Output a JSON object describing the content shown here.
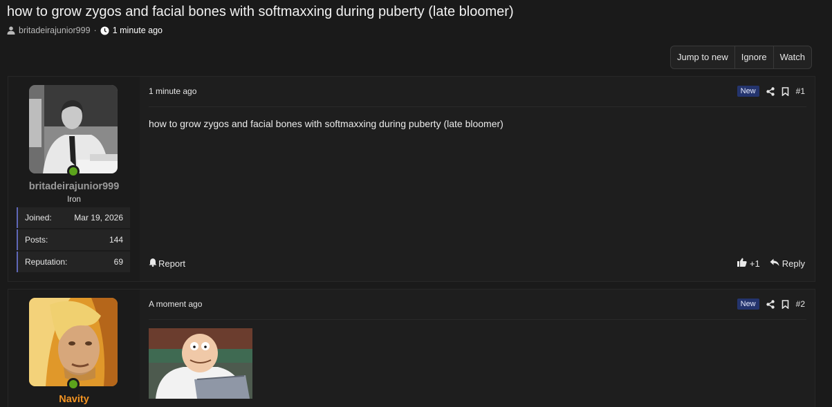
{
  "thread": {
    "title": "how to grow zygos and facial bones with softmaxxing during puberty (late bloomer)",
    "author": "britadeirajunior999",
    "separator": "·",
    "time": "1 minute ago"
  },
  "actions": {
    "jump_to_new": "Jump to new",
    "ignore": "Ignore",
    "watch": "Watch"
  },
  "posts": [
    {
      "username": "britadeirajunior999",
      "user_title": "Iron",
      "stats": [
        {
          "label": "Joined:",
          "value": "Mar 19, 2026"
        },
        {
          "label": "Posts:",
          "value": "144"
        },
        {
          "label": "Reputation:",
          "value": "69"
        }
      ],
      "date": "1 minute ago",
      "badge": "New",
      "number": "#1",
      "body": "how to grow zygos and facial bones with softmaxxing during puberty (late bloomer)",
      "report": "Report",
      "likes": "+1",
      "reply": "Reply"
    },
    {
      "username": "Navity",
      "date": "A moment ago",
      "badge": "New",
      "number": "#2"
    }
  ],
  "colors": {
    "background": "#1a1a1a",
    "online": "#5ca31c",
    "username_orange": "#f29322",
    "badge_bg": "#24346d",
    "stat_accent": "#5f68b8"
  }
}
